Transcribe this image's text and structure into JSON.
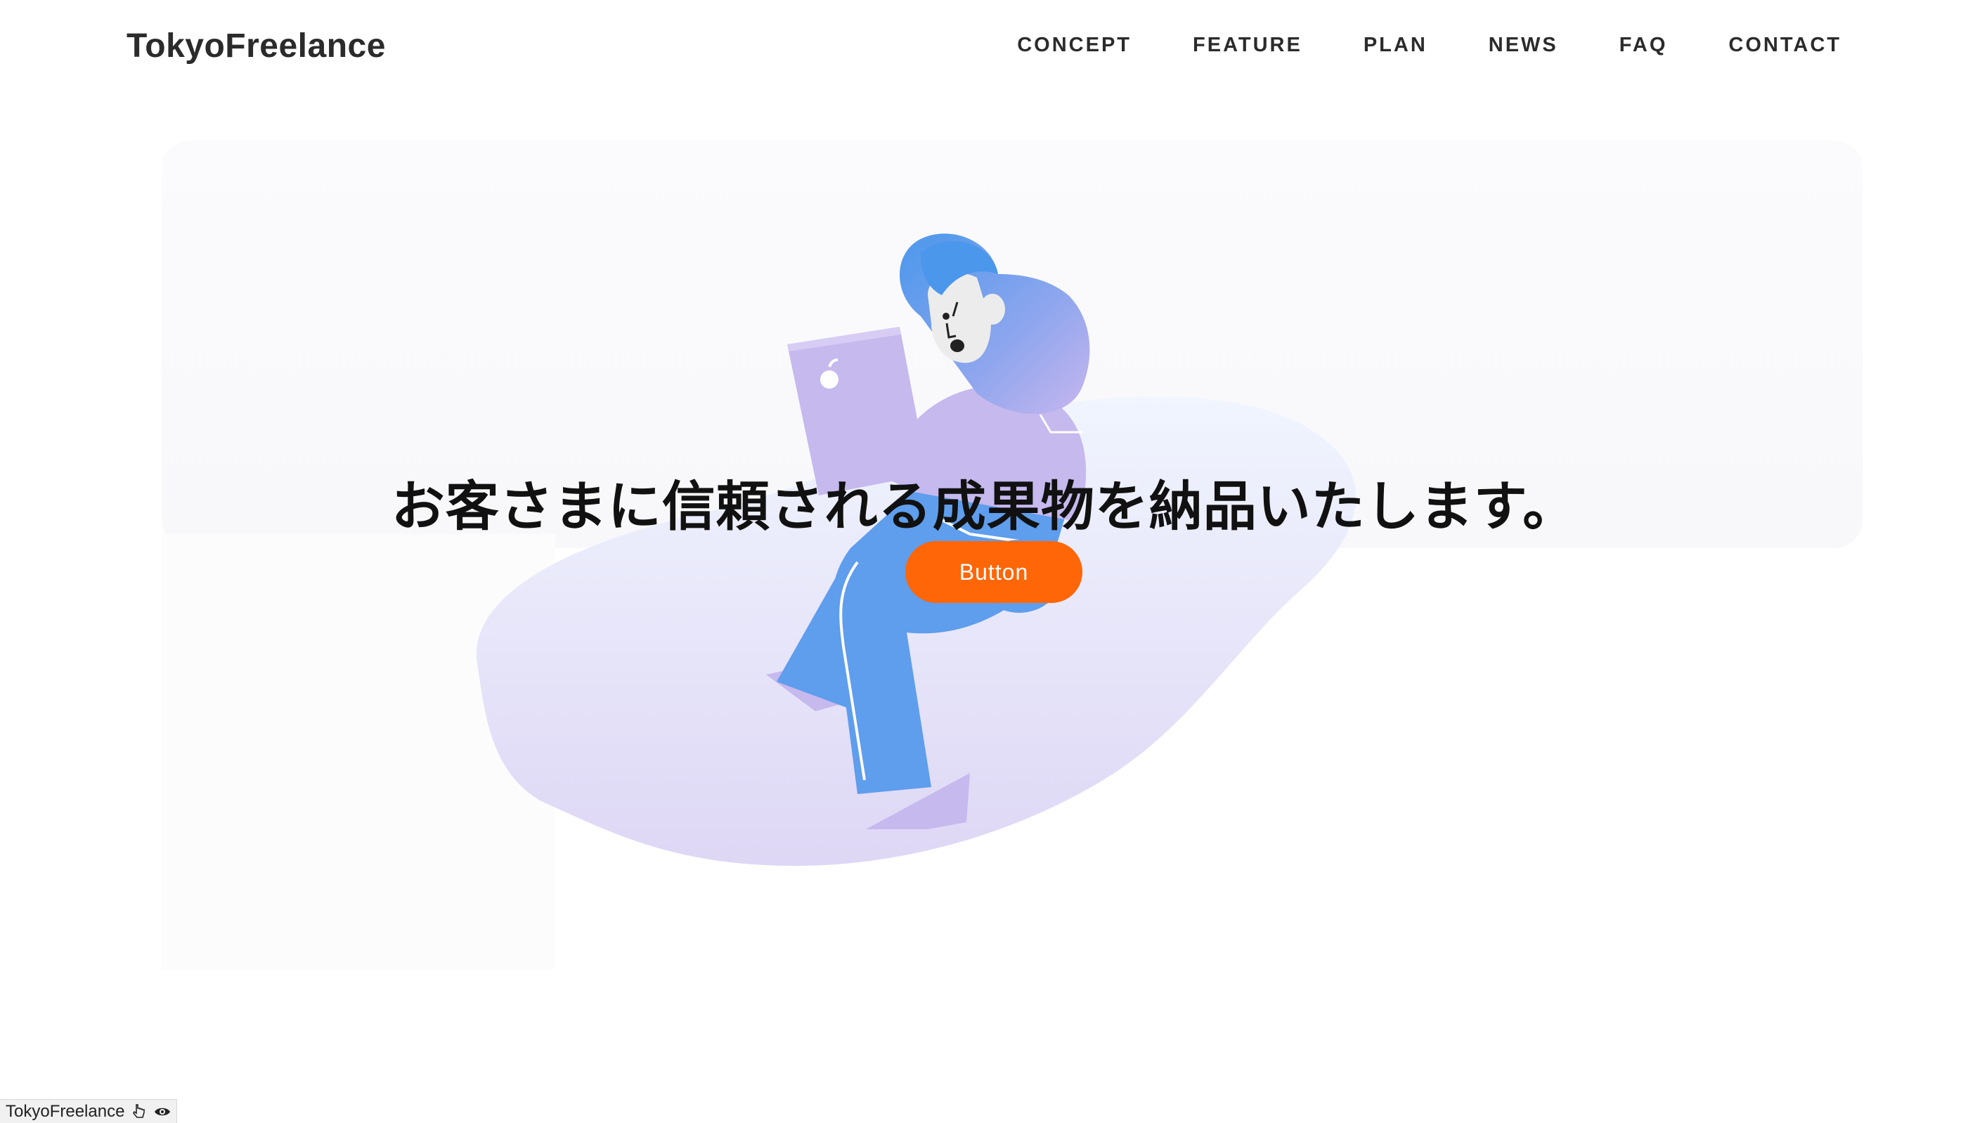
{
  "header": {
    "logo": "TokyoFreelance",
    "nav": [
      {
        "label": "CONCEPT"
      },
      {
        "label": "FEATURE"
      },
      {
        "label": "PLAN"
      },
      {
        "label": "NEWS"
      },
      {
        "label": "FAQ"
      },
      {
        "label": "CONTACT"
      }
    ]
  },
  "hero": {
    "headline": "お客さまに信頼される成果物を納品いたします。",
    "button_label": "Button",
    "illustration": "person-with-laptop-illustration"
  },
  "debug_tag": {
    "label": "TokyoFreelance",
    "icons": [
      "pointer-icon",
      "eye-icon"
    ]
  },
  "colors": {
    "accent": "#ff6607",
    "text": "#2b2b2b",
    "blob_top": "#eef3fd",
    "blob_bottom": "#e1dbf6",
    "figure_blue": "#5f9ded",
    "figure_lavender": "#c6b9ee"
  }
}
